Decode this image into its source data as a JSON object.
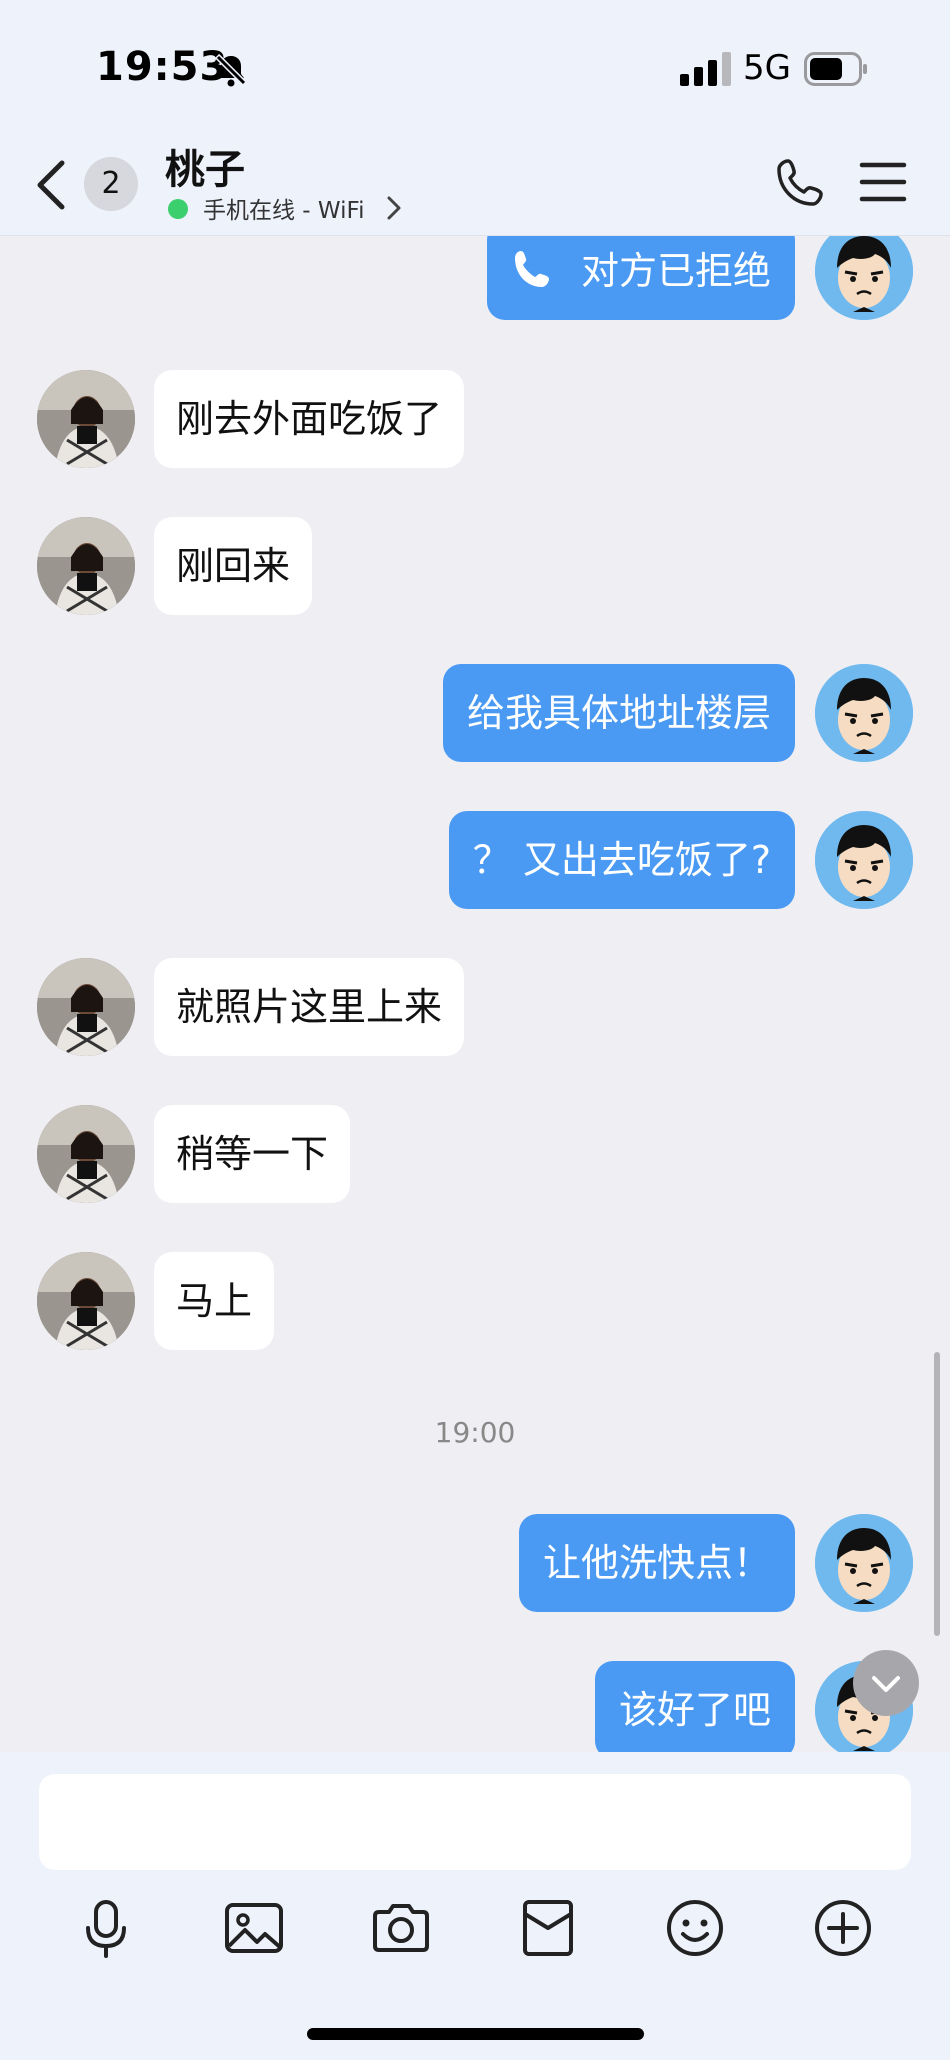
{
  "status_bar": {
    "time": "19:53",
    "network": "5G"
  },
  "header": {
    "unread_count": "2",
    "contact_name": "桃子",
    "online_status": "手机在线 - WiFi"
  },
  "messages": [
    {
      "from": "me",
      "text": "对方已拒绝",
      "kind": "call"
    },
    {
      "from": "peer",
      "text": "刚去外面吃饭了"
    },
    {
      "from": "peer",
      "text": "刚回来"
    },
    {
      "from": "me",
      "text": "给我具体地址楼层"
    },
    {
      "from": "me",
      "text": "？ 又出去吃饭了?"
    },
    {
      "from": "peer",
      "text": "就照片这里上来"
    },
    {
      "from": "peer",
      "text": "稍等一下"
    },
    {
      "from": "peer",
      "text": "马上"
    },
    {
      "from": "me",
      "text": "让他洗快点！"
    },
    {
      "from": "me",
      "text": "该好了吧"
    }
  ],
  "timestamp": "19:00",
  "input": {
    "value": "",
    "placeholder": ""
  },
  "toolbar": [
    "microphone-icon",
    "image-icon",
    "camera-icon",
    "file-icon",
    "emoji-icon",
    "plus-icon"
  ],
  "colors": {
    "my_bubble": "#4a9af3",
    "peer_bubble": "#ffffff",
    "online": "#3ccf6e"
  }
}
